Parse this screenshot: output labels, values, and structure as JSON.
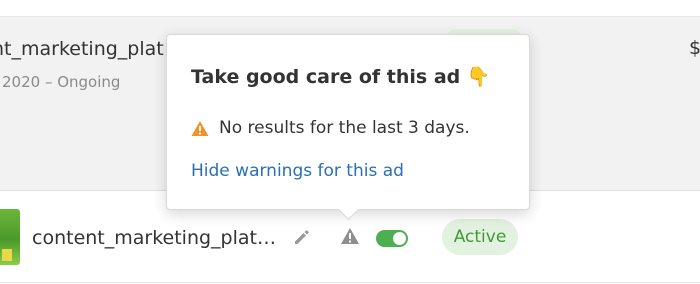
{
  "top_row": {
    "campaign_title": "nt_marketing_plat",
    "dates": "2020 – Ongoing",
    "right_text": "$"
  },
  "ad_row": {
    "title": "content_marketing_plat…",
    "status": "Active",
    "toggle_on": true,
    "status_color": "#3f9a3a",
    "toggle_color": "#4caf50"
  },
  "popover": {
    "title": "Take good care of this ad 👇",
    "warning_text": "No results for the last 3 days.",
    "hide_link": "Hide warnings for this ad",
    "warning_icon": "warning-triangle-icon",
    "warning_color": "#f0922d",
    "link_color": "#2a6fb5"
  }
}
